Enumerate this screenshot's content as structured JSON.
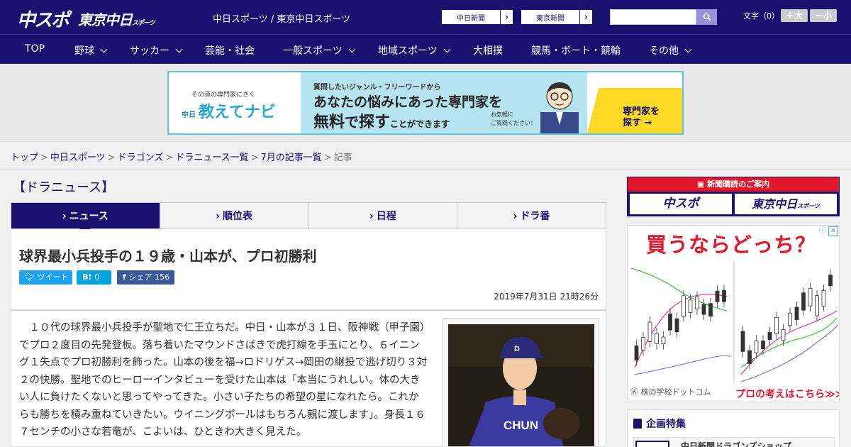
{
  "header": {
    "logo_main": "中スポ",
    "logo_tokyo": "東京中日",
    "logo_tokyo_sub": "スポーツ",
    "site_title": "中日スポーツ / 東京中日スポーツ",
    "link_chunichi": "中日新聞",
    "link_tokyo": "東京新聞",
    "search_placeholder": "",
    "font_label": "文字（0）",
    "font_plus": "＋大",
    "font_minus": "－小"
  },
  "nav": {
    "items": [
      {
        "label": "TOP",
        "dropdown": false
      },
      {
        "label": "野球",
        "dropdown": true
      },
      {
        "label": "サッカー",
        "dropdown": true
      },
      {
        "label": "芸能・社会",
        "dropdown": false
      },
      {
        "label": "一般スポーツ",
        "dropdown": true
      },
      {
        "label": "地域スポーツ",
        "dropdown": true
      },
      {
        "label": "大相撲",
        "dropdown": false
      },
      {
        "label": "競馬・ボート・競輪",
        "dropdown": false
      },
      {
        "label": "その他",
        "dropdown": true
      }
    ]
  },
  "banner": {
    "small": "その道の専門家にきく",
    "logo_chu": "中日",
    "logo": "教えてナビ",
    "line1": "質問したいジャンル・フリーワードから",
    "line2": "あなたの悩みにあった専門家を",
    "line3_a": "無料",
    "line3_b": "で",
    "line3_c": "探す",
    "line3_d": "ことができます",
    "note1": "お気軽に",
    "note2": "ご質問ください！",
    "cta1": "専門家を",
    "cta2": "探す →"
  },
  "breadcrumb": {
    "items": [
      "トップ",
      "中日スポーツ",
      "ドラゴンズ",
      "ドラニュース一覧",
      "7月の記事一覧"
    ],
    "current": "記事",
    "sep": ">"
  },
  "section_title": "【ドラニュース】",
  "tabs": [
    {
      "label": "ニュース",
      "active": true
    },
    {
      "label": "順位表",
      "active": false
    },
    {
      "label": "日程",
      "active": false
    },
    {
      "label": "ドラ番",
      "active": false
    }
  ],
  "article": {
    "headline": "球界最小兵投手の１９歳・山本が、プロ初勝利",
    "share_tweet": "ツイート",
    "share_hatena_count": "0",
    "share_fb_label": "シェア",
    "share_fb_count": "156",
    "date": "2019年7月31日 21時26分",
    "body": "　１０代の球界最小兵投手が聖地で仁王立ちだ。中日・山本が３１日、阪神戦（甲子園）でプロ２度目の先発登板。落ち着いたマウンドさばきで虎打線を手玉にとり、６イニング１失点でプロ初勝利を飾った。山本の後を福→ロドリゲス→岡田の継投で逃げ切り３対２の快勝。聖地でのヒーローインタビューを受けた山本は「本当にうれしい。体の大きい人に負けたくないと思ってやってきた。小さい子たちの希望の星になれたら。これからも勝ちを積み重ねていきたい。ウイニングボールはもちろん親に渡します」。身長１６７センチの小さな若竜が、こよいは、ひときわ大きく見えた。",
    "photo_jersey": "CHUN"
  },
  "sidebar": {
    "subscribe_header": "新聞購読のご案内",
    "subscribe_logo1": "中スポ",
    "subscribe_logo2": "東京中日",
    "subscribe_logo2_sub": "スポーツ",
    "ad_title": "買うならどっち？",
    "ad_footer_left": "株の学校ドットコム",
    "ad_footer_right": "プロの考えはこちら≫≫",
    "feature_title": "企画特集",
    "feature_item": "中日新聞ドラゴンズショップ"
  },
  "colors": {
    "brand": "#1a1070",
    "accent_red": "#e0172c",
    "banner_cyan": "#5bc8e0",
    "cta_yellow": "#fcd924"
  }
}
